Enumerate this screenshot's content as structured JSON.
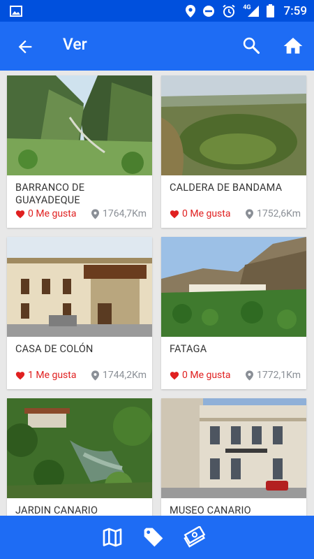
{
  "status_bar": {
    "time": "7:59",
    "network": "4G"
  },
  "app_bar": {
    "title": "Ver"
  },
  "places": [
    {
      "name": "BARRANCO DE GUAYADEQUE",
      "likes": "0 Me gusta",
      "distance": "1764,7Km"
    },
    {
      "name": "CALDERA DE BANDAMA",
      "likes": "0 Me gusta",
      "distance": "1752,6Km"
    },
    {
      "name": "CASA DE COLÓN",
      "likes": "1 Me gusta",
      "distance": "1744,2Km"
    },
    {
      "name": "FATAGA",
      "likes": "0 Me gusta",
      "distance": "1772,1Km"
    },
    {
      "name": "JARDIN CANARIO",
      "likes": "",
      "distance": ""
    },
    {
      "name": "MUSEO CANARIO",
      "likes": "",
      "distance": ""
    }
  ],
  "colors": {
    "status_bar": "#0050dd",
    "app_bar": "#1e6cf4",
    "like": "#e02020",
    "distance": "#8a8f96"
  },
  "bottom_nav": {
    "icons": [
      "map-icon",
      "tag-icon",
      "money-icon"
    ]
  }
}
